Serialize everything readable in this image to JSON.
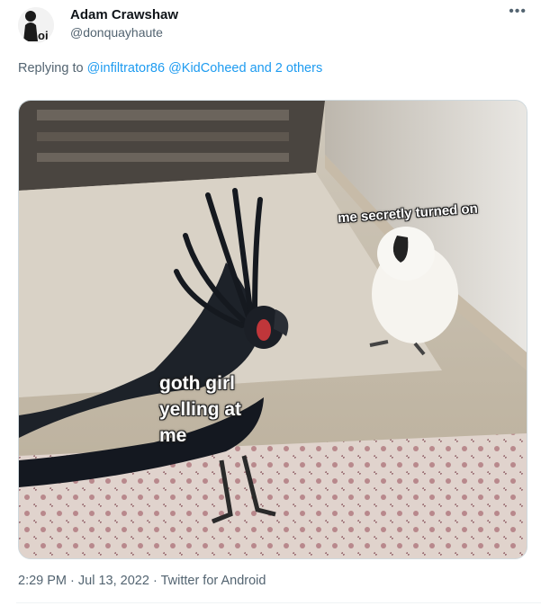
{
  "tweet": {
    "author_name": "Adam Crawshaw",
    "author_handle": "@donquayhaute",
    "avatar_text": "oi",
    "more_label": "•••",
    "replying_prefix": "Replying to",
    "replying_to_1": "@infiltrator86",
    "replying_to_2": "@KidCoheed",
    "replying_others": "and 2 others",
    "meme": {
      "caption_top": "me secretly turned on",
      "caption_bottom": "goth girl\nyelling at\nme"
    },
    "time": "2:29 PM",
    "date": "Jul 13, 2022",
    "source": "Twitter for Android",
    "separator": "·"
  },
  "colors": {
    "link": "#1d9bf0",
    "secondary_text": "#536471",
    "primary_text": "#0f1419"
  }
}
